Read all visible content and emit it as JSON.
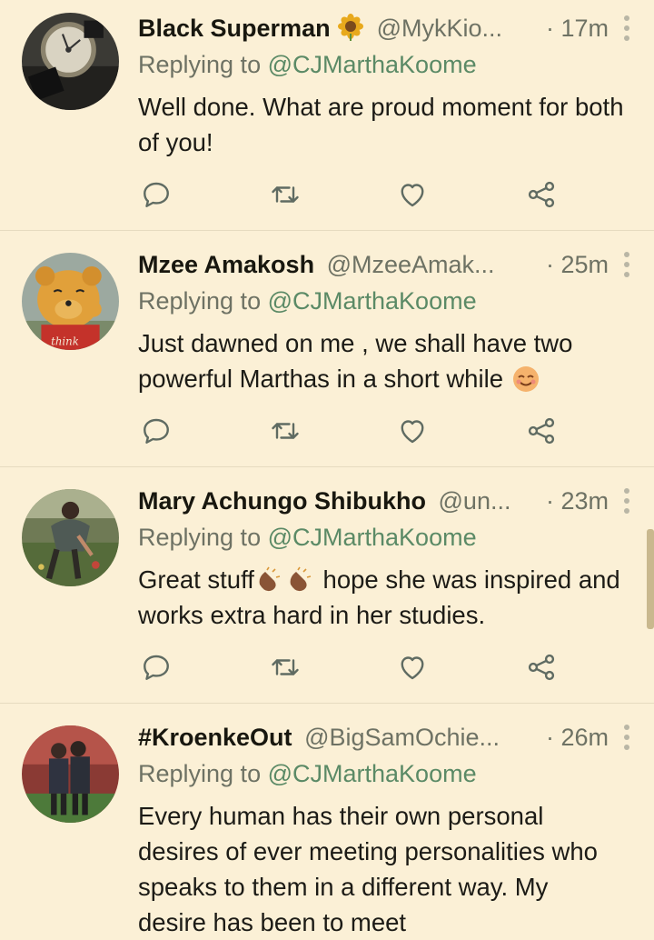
{
  "tweets": [
    {
      "name": "Black Superman",
      "name_emoji": "sunflower-emoji",
      "handle": "@MykKio...",
      "time": "· 17m",
      "reply_prefix": "Replying to",
      "reply_to": "@CJMarthaKoome",
      "text": "Well done. What are proud moment for both of you!",
      "avatar": "watch-photo"
    },
    {
      "name": "Mzee Amakosh",
      "handle": "@MzeeAmak...",
      "time": "· 25m",
      "reply_prefix": "Replying to",
      "reply_to": "@CJMarthaKoome",
      "text": "Just dawned on me , we shall have two powerful Marthas in a short while",
      "text_emoji": "smiling-face-emoji",
      "avatar": "winnie-the-pooh-think",
      "avatar_caption": "think"
    },
    {
      "name": "Mary Achungo Shibukho",
      "handle": "@un...",
      "time": "· 23m",
      "reply_prefix": "Replying to",
      "reply_to": "@CJMarthaKoome",
      "text_part1": "Great stuff",
      "text_part2": " hope she was inspired and works extra hard in her studies.",
      "text_emoji": "clapping-hands-emoji",
      "avatar": "person-in-garden"
    },
    {
      "name": "#KroenkeOut",
      "handle": "@BigSamOchie...",
      "time": "· 26m",
      "reply_prefix": "Replying to",
      "reply_to": "@CJMarthaKoome",
      "text": "Every human has their own personal desires of ever meeting personalities who speaks to them in a different way. My desire has been to meet",
      "avatar": "footballers-stadium"
    }
  ],
  "icons": {
    "reply": "reply-icon",
    "retweet": "retweet-icon",
    "like": "heart-icon",
    "share": "share-icon",
    "more": "more-vertical-icon"
  },
  "colors": {
    "background": "#fbf0d6",
    "secondary_text": "#6e7264",
    "mention": "#5b8a66",
    "icon": "#5f6b62"
  }
}
